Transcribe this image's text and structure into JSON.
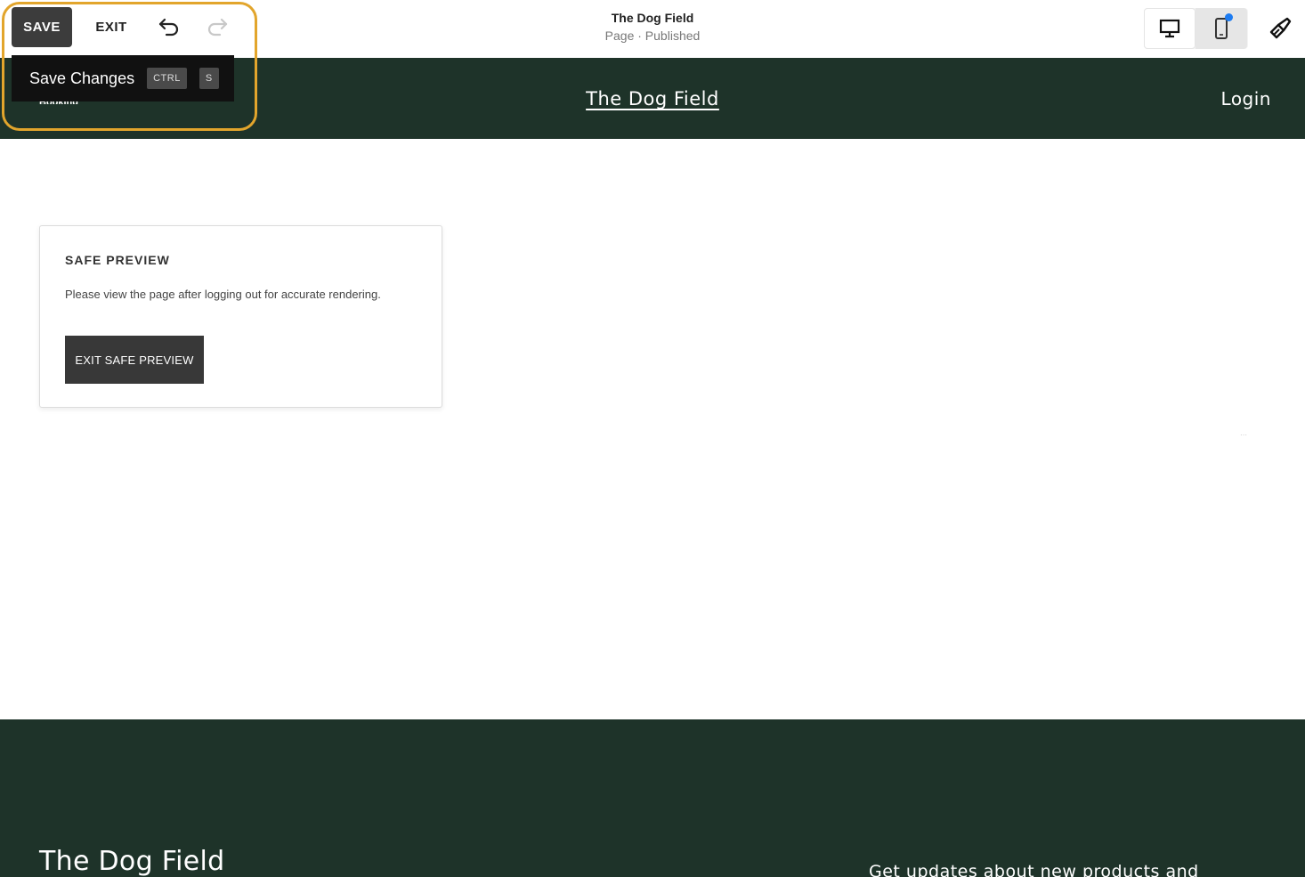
{
  "toolbar": {
    "save_label": "SAVE",
    "exit_label": "EXIT",
    "site_title": "The Dog Field",
    "page_status": "Page · Published"
  },
  "tooltip": {
    "label": "Save Changes",
    "key1": "CTRL",
    "key2": "S"
  },
  "site_header": {
    "nav_partial": "Booking",
    "title": "The Dog Field",
    "login": "Login"
  },
  "preview_card": {
    "title": "SAFE PREVIEW",
    "text": "Please view the page after logging out for accurate rendering.",
    "button": "EXIT SAFE PREVIEW"
  },
  "footer": {
    "title": "The Dog Field",
    "text": "Get updates about new products and"
  },
  "colors": {
    "header_bg": "#1e3329",
    "highlight": "#e2a52c",
    "notification": "#1d7cf2"
  },
  "icons": [
    "undo-icon",
    "redo-icon",
    "desktop-icon",
    "mobile-icon",
    "paintbrush-icon"
  ]
}
